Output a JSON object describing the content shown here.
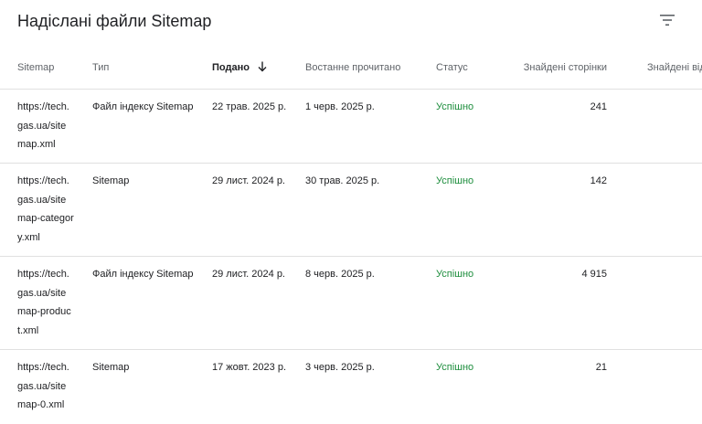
{
  "header": {
    "title": "Надіслані файли Sitemap"
  },
  "table": {
    "columns": {
      "sitemap": "Sitemap",
      "type": "Тип",
      "submitted": "Подано",
      "last_read": "Востанне прочитано",
      "status": "Статус",
      "pages": "Знайдені сторінки",
      "videos": "Знайдені від"
    },
    "rows": [
      {
        "sitemap": "https://tech.gas.ua/sitemap.xml",
        "type": "Файл індексу Sitemap",
        "submitted": "22 трав. 2025 р.",
        "last_read": "1 черв. 2025 р.",
        "status": "Успішно",
        "pages": "241"
      },
      {
        "sitemap": "https://tech.gas.ua/sitemap-category.xml",
        "type": "Sitemap",
        "submitted": "29 лист. 2024 р.",
        "last_read": "30 трав. 2025 р.",
        "status": "Успішно",
        "pages": "142"
      },
      {
        "sitemap": "https://tech.gas.ua/sitemap-product.xml",
        "type": "Файл індексу Sitemap",
        "submitted": "29 лист. 2024 р.",
        "last_read": "8 черв. 2025 р.",
        "status": "Успішно",
        "pages": "4 915"
      },
      {
        "sitemap": "https://tech.gas.ua/sitemap-0.xml",
        "type": "Sitemap",
        "submitted": "17 жовт. 2023 р.",
        "last_read": "3 черв. 2025 р.",
        "status": "Успішно",
        "pages": "21"
      }
    ]
  },
  "colors": {
    "status_success": "#1e8e3e",
    "border": "#e0e0e0"
  },
  "icons": {
    "filter": "filter-icon",
    "sort": "arrow-down-icon"
  }
}
